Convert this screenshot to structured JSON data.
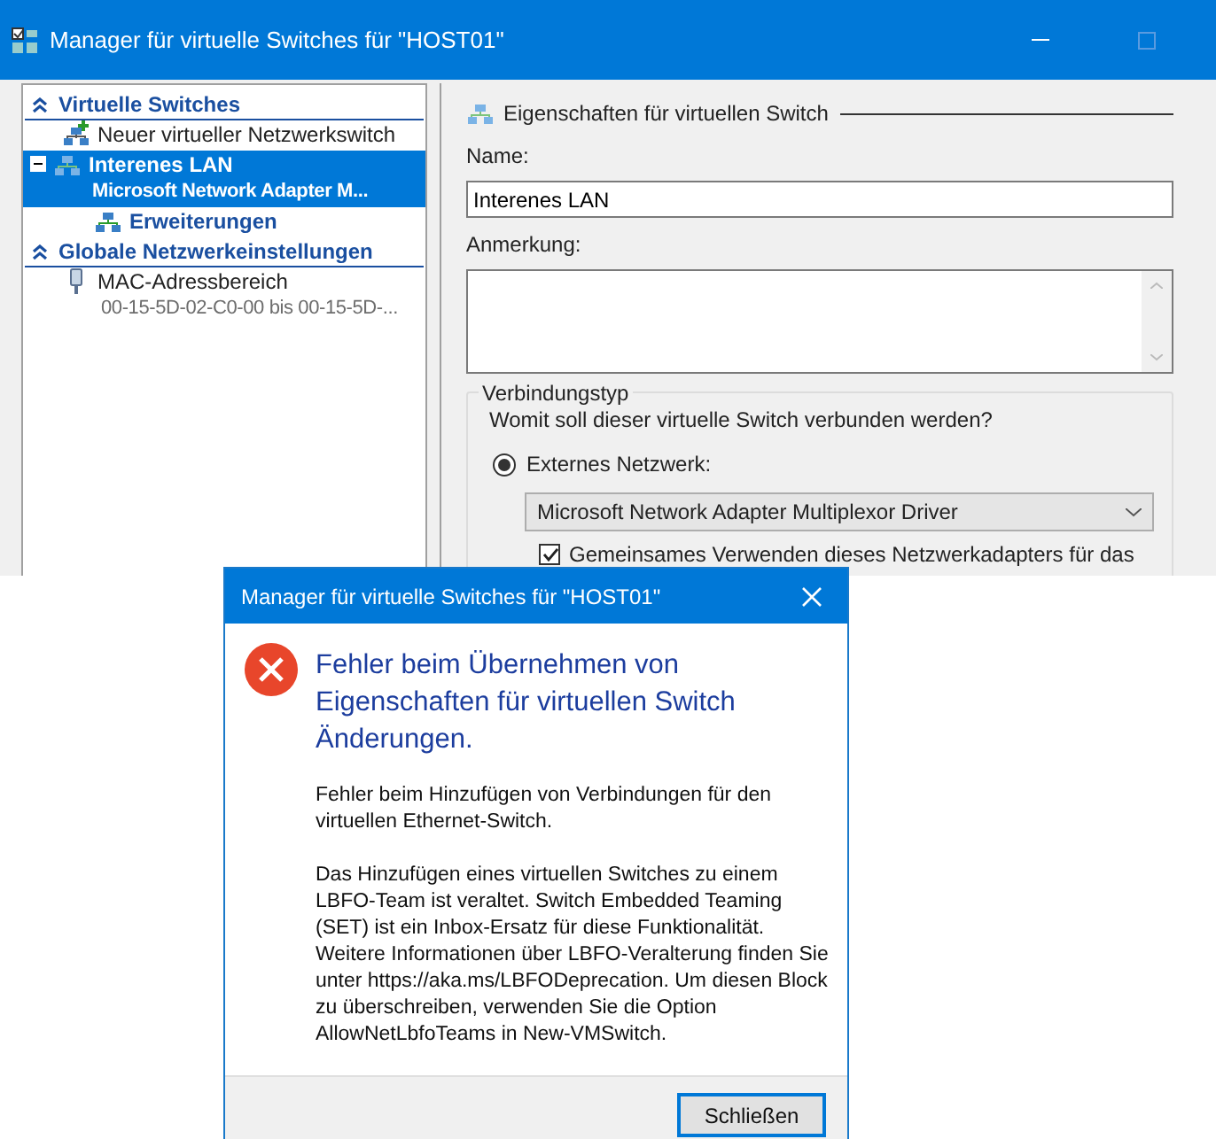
{
  "window": {
    "title": "Manager für virtuelle Switches für \"HOST01\""
  },
  "tree": [
    {
      "kind": "section",
      "label": "Virtuelle Switches",
      "expanded": true,
      "children": [
        {
          "kind": "add",
          "label": "Neuer virtueller Netzwerkswitch",
          "selected": false
        },
        {
          "kind": "switch",
          "label": "Interenes LAN",
          "detail": "Microsoft Network Adapter M...",
          "selected": true,
          "expanded": true,
          "children": [
            {
              "kind": "extension",
              "label": "Erweiterungen",
              "selected": false
            }
          ]
        }
      ]
    },
    {
      "kind": "section",
      "label": "Globale Netzwerkeinstellungen",
      "expanded": true,
      "children": [
        {
          "kind": "address",
          "label": "MAC-Adressbereich",
          "detail": "00-15-5D-02-C0-00 bis 00-15-5D-...",
          "selected": false
        }
      ]
    }
  ],
  "properties": {
    "heading": "Eigenschaften für virtuellen Switch",
    "name_label": "Name:",
    "name_value": "Interenes LAN",
    "note_label": "Anmerkung:",
    "connection": {
      "legend": "Verbindungstyp",
      "question": "Womit soll dieser virtuelle Switch verbunden werden?",
      "options": [
        {
          "label": "Externes Netzwerk:",
          "selected": true
        }
      ],
      "adapter": "Microsoft Network Adapter Multiplexor Driver",
      "share_checkbox": {
        "label": "Gemeinsames Verwenden dieses Netzwerkadapters für das",
        "checked": true
      }
    }
  },
  "dialog": {
    "title": "Manager für virtuelle Switches für \"HOST01\"",
    "heading": "Fehler beim Übernehmen von Eigenschaften für virtuellen Switch Änderungen.",
    "messages": [
      "Fehler beim Hinzufügen von Verbindungen für den virtuellen Ethernet-Switch.",
      "Das Hinzufügen eines virtuellen Switches zu einem LBFO-Team ist veraltet. Switch Embedded Teaming (SET) ist ein Inbox-Ersatz für diese Funktionalität. Weitere Informationen über LBFO-Veralterung finden Sie unter https://aka.ms/LBFODeprecation. Um diesen Block zu überschreiben, verwenden Sie die Option AllowNetLbfoTeams in New-VMSwitch."
    ],
    "close_button": "Schließen"
  }
}
